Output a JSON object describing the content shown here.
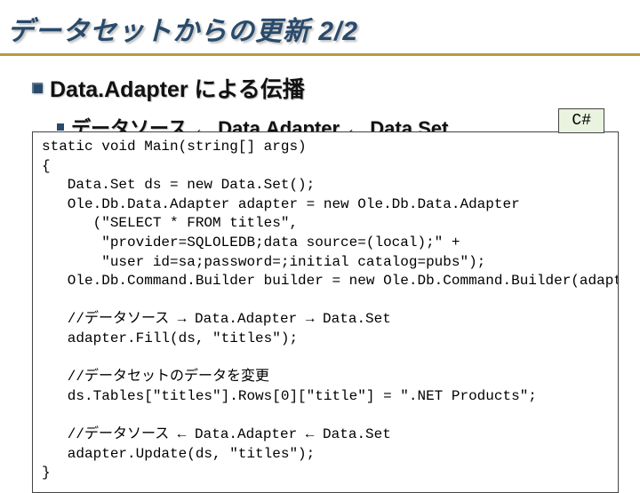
{
  "title": "データセットからの更新 2/2",
  "heading2": "Data.Adapter による伝播",
  "heading3": "データソース ← Data.Adapter ← Data.Set",
  "badge": "C#",
  "code": "static void Main(string[] args)\n{\n   Data.Set ds = new Data.Set();\n   Ole.Db.Data.Adapter adapter = new Ole.Db.Data.Adapter\n      (\"SELECT * FROM titles\",\n       \"provider=SQLOLEDB;data source=(local);\" +\n       \"user id=sa;password=;initial catalog=pubs\");\n   Ole.Db.Command.Builder builder = new Ole.Db.Command.Builder(adapter);\n\n   //データソース → Data.Adapter → Data.Set\n   adapter.Fill(ds, \"titles\");\n\n   //データセットのデータを変更\n   ds.Tables[\"titles\"].Rows[0][\"title\"] = \".NET Products\";\n\n   //データソース ← Data.Adapter ← Data.Set\n   adapter.Update(ds, \"titles\");\n}"
}
